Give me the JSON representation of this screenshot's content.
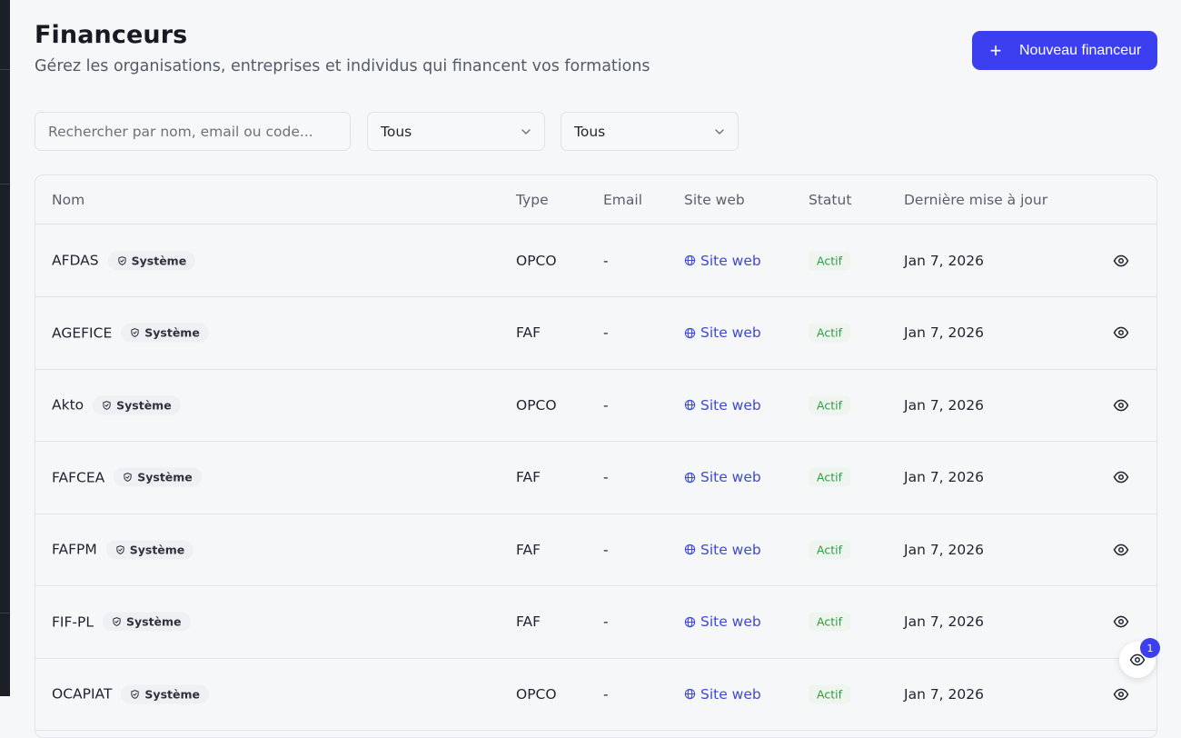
{
  "header": {
    "title": "Financeurs",
    "subtitle": "Gérez les organisations, entreprises et individus qui financent vos formations",
    "new_button_label": "Nouveau financeur"
  },
  "filters": {
    "search_placeholder": "Rechercher par nom, email ou code...",
    "type_select_value": "Tous",
    "status_select_value": "Tous"
  },
  "table": {
    "columns": [
      "Nom",
      "Type",
      "Email",
      "Site web",
      "Statut",
      "Dernière mise à jour"
    ],
    "rows": [
      {
        "name": "AFDAS",
        "badge": "Système",
        "type": "OPCO",
        "email": "-",
        "website": "Site web",
        "status": "Actif",
        "updated": "Jan 7, 2026"
      },
      {
        "name": "AGEFICE",
        "badge": "Système",
        "type": "FAF",
        "email": "-",
        "website": "Site web",
        "status": "Actif",
        "updated": "Jan 7, 2026"
      },
      {
        "name": "Akto",
        "badge": "Système",
        "type": "OPCO",
        "email": "-",
        "website": "Site web",
        "status": "Actif",
        "updated": "Jan 7, 2026"
      },
      {
        "name": "FAFCEA",
        "badge": "Système",
        "type": "FAF",
        "email": "-",
        "website": "Site web",
        "status": "Actif",
        "updated": "Jan 7, 2026"
      },
      {
        "name": "FAFPM",
        "badge": "Système",
        "type": "FAF",
        "email": "-",
        "website": "Site web",
        "status": "Actif",
        "updated": "Jan 7, 2026"
      },
      {
        "name": "FIF-PL",
        "badge": "Système",
        "type": "FAF",
        "email": "-",
        "website": "Site web",
        "status": "Actif",
        "updated": "Jan 7, 2026"
      },
      {
        "name": "OCAPIAT",
        "badge": "Système",
        "type": "OPCO",
        "email": "-",
        "website": "Site web",
        "status": "Actif",
        "updated": "Jan 7, 2026"
      }
    ]
  },
  "floating": {
    "badge_count": "1"
  },
  "icons": {
    "plus": "plus-icon",
    "chevron": "chevron-down-icon",
    "shield": "shield-icon",
    "globe": "globe-icon",
    "eye": "eye-icon"
  },
  "colors": {
    "primary": "#3b3ff0",
    "link": "#3f49d6",
    "status_active": "#2f9a44",
    "sidebar": "#1c1f26"
  }
}
